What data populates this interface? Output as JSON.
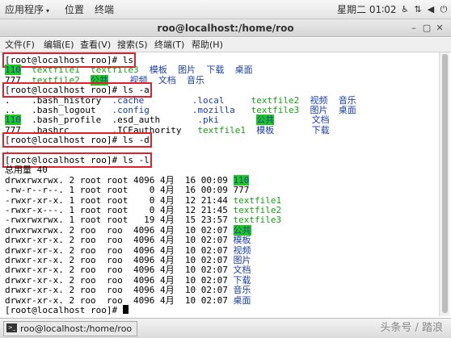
{
  "topbar": {
    "applications_label": "应用程序",
    "places_label": "位置",
    "terminal_label": "终端",
    "clock": "星期二 01∶02",
    "icons": [
      "accessibility-icon",
      "network-icon",
      "volume-icon",
      "power-icon"
    ]
  },
  "window": {
    "title": "roo@localhost:/home/roo",
    "menu": [
      "文件(F)",
      "编辑(E)",
      "查看(V)",
      "搜索(S)",
      "终端(T)",
      "帮助(H)"
    ]
  },
  "terminal": {
    "colors": {
      "dir": "#1a3ea8",
      "file": "#16a116",
      "highlight_bg": "#1ec81e",
      "box": "#e0212b"
    },
    "lines": [
      [
        {
          "t": "[root@localhost roo]# ls",
          "c": "",
          "box": true
        }
      ],
      [
        {
          "t": "110",
          "c": "hl"
        },
        {
          "t": "  textfile1  textfile3  ",
          "c": "green"
        },
        {
          "t": "模板  图片  下载  桌面",
          "c": "blue"
        }
      ],
      [
        {
          "t": "777  ",
          "c": ""
        },
        {
          "t": "textfile2  ",
          "c": "green"
        },
        {
          "t": "公共",
          "c": "hl"
        },
        {
          "t": "    视频  文档  音乐",
          "c": "blue"
        }
      ],
      [
        {
          "t": "[root@localhost roo]# ls -a",
          "c": "",
          "box": true
        }
      ],
      [
        {
          "t": ".    .bash_history  ",
          "c": ""
        },
        {
          "t": ".cache         .local     ",
          "c": "blue"
        },
        {
          "t": "textfile2  ",
          "c": "green"
        },
        {
          "t": "视频  音乐",
          "c": "blue"
        }
      ],
      [
        {
          "t": "..   .bash_logout   ",
          "c": ""
        },
        {
          "t": ".config        .mozilla   ",
          "c": "blue"
        },
        {
          "t": "textfile3  ",
          "c": "green"
        },
        {
          "t": "图片  桌面",
          "c": "blue"
        }
      ],
      [
        {
          "t": "110",
          "c": "hl"
        },
        {
          "t": "  .bash_profile  .esd_auth       ",
          "c": ""
        },
        {
          "t": ".pki       ",
          "c": "blue"
        },
        {
          "t": "公共",
          "c": "hl"
        },
        {
          "t": "       文档",
          "c": "blue"
        }
      ],
      [
        {
          "t": "777  .bashrc        .ICEauthority   ",
          "c": ""
        },
        {
          "t": "textfile1  ",
          "c": "green"
        },
        {
          "t": "模板       下载",
          "c": "blue"
        }
      ],
      [
        {
          "t": "[root@localhost roo]# ls -d",
          "c": "",
          "box": true
        }
      ],
      [
        {
          "t": ".",
          "c": ""
        }
      ],
      [
        {
          "t": "[root@localhost roo]# ls -l",
          "c": "",
          "box": true
        }
      ],
      [
        {
          "t": "总用量 40",
          "c": ""
        }
      ],
      [
        {
          "t": "drwxrwxrwx. 2 root root 4096 4月  16 00:09 ",
          "c": ""
        },
        {
          "t": "110",
          "c": "hl"
        }
      ],
      [
        {
          "t": "-rw-r--r--. 1 root root    0 4月  16 00:09 777",
          "c": ""
        }
      ],
      [
        {
          "t": "-rwxr-xr-x. 1 root root    0 4月  12 21:44 ",
          "c": ""
        },
        {
          "t": "textfile1",
          "c": "green"
        }
      ],
      [
        {
          "t": "-rwxr-x---. 1 root root    0 4月  12 21:45 ",
          "c": ""
        },
        {
          "t": "textfile2",
          "c": "green"
        }
      ],
      [
        {
          "t": "-rwxrwxrwx. 1 root root   19 4月  15 23:57 ",
          "c": ""
        },
        {
          "t": "textfile3",
          "c": "green"
        }
      ],
      [
        {
          "t": "drwxrwxrwx. 2 roo  roo  4096 4月  10 02:07 ",
          "c": ""
        },
        {
          "t": "公共",
          "c": "hl"
        }
      ],
      [
        {
          "t": "drwxr-xr-x. 2 roo  roo  4096 4月  10 02:07 ",
          "c": ""
        },
        {
          "t": "模板",
          "c": "blue"
        }
      ],
      [
        {
          "t": "drwxr-xr-x. 2 roo  roo  4096 4月  10 02:07 ",
          "c": ""
        },
        {
          "t": "视频",
          "c": "blue"
        }
      ],
      [
        {
          "t": "drwxr-xr-x. 2 roo  roo  4096 4月  10 02:07 ",
          "c": ""
        },
        {
          "t": "图片",
          "c": "blue"
        }
      ],
      [
        {
          "t": "drwxr-xr-x. 2 roo  roo  4096 4月  10 02:07 ",
          "c": ""
        },
        {
          "t": "文档",
          "c": "blue"
        }
      ],
      [
        {
          "t": "drwxr-xr-x. 2 roo  roo  4096 4月  10 02:07 ",
          "c": ""
        },
        {
          "t": "下载",
          "c": "blue"
        }
      ],
      [
        {
          "t": "drwxr-xr-x. 2 roo  roo  4096 4月  10 02:07 ",
          "c": ""
        },
        {
          "t": "音乐",
          "c": "blue"
        }
      ],
      [
        {
          "t": "drwxr-xr-x. 2 roo  roo  4096 4月  10 02:07 ",
          "c": ""
        },
        {
          "t": "桌面",
          "c": "blue"
        }
      ],
      [
        {
          "t": "[root@localhost roo]# ",
          "c": ""
        }
      ]
    ]
  },
  "taskbar": {
    "task_label": "roo@localhost:/home/roo",
    "watermark": "头条号 / 踏浪"
  }
}
